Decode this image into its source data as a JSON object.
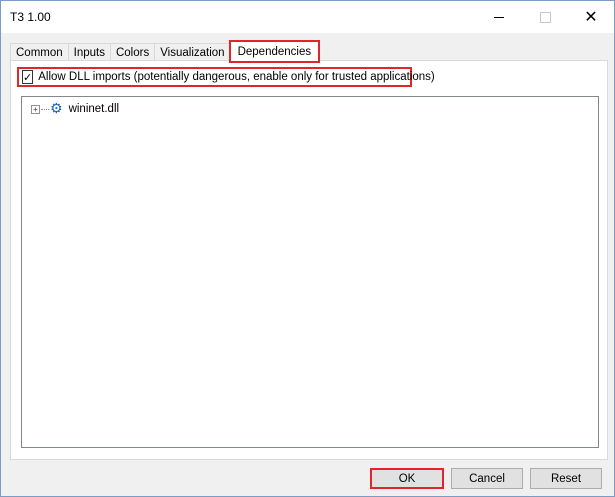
{
  "window": {
    "title": "T3 1.00"
  },
  "tabs": [
    {
      "label": "Common"
    },
    {
      "label": "Inputs"
    },
    {
      "label": "Colors"
    },
    {
      "label": "Visualization"
    },
    {
      "label": "Dependencies",
      "active": true
    }
  ],
  "dependencies": {
    "allow_dll_label": "Allow DLL imports (potentially dangerous, enable only for trusted applications)",
    "allow_dll_checked": true,
    "tree": [
      {
        "label": "wininet.dll",
        "icon": "gear-icon"
      }
    ]
  },
  "buttons": {
    "ok": "OK",
    "cancel": "Cancel",
    "reset": "Reset"
  },
  "colors": {
    "highlight": "#e0262d",
    "gear": "#1c5fb8"
  }
}
